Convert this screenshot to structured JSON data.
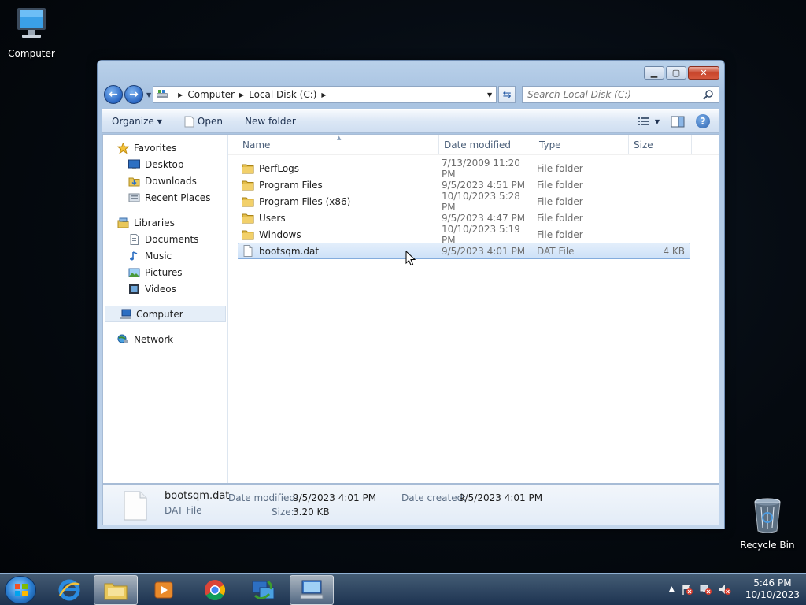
{
  "desktop": {
    "icons": [
      {
        "label": "Computer",
        "icon": "computer-icon"
      },
      {
        "label": "Recycle Bin",
        "icon": "recycle-bin-icon"
      }
    ]
  },
  "window": {
    "address": {
      "crumbs": [
        "Computer",
        "Local Disk (C:)"
      ],
      "search_placeholder": "Search Local Disk (C:)"
    },
    "toolbar": {
      "organize": "Organize",
      "open": "Open",
      "new_folder": "New folder"
    },
    "nav_pane": {
      "favorites": {
        "label": "Favorites",
        "items": [
          "Desktop",
          "Downloads",
          "Recent Places"
        ]
      },
      "libraries": {
        "label": "Libraries",
        "items": [
          "Documents",
          "Music",
          "Pictures",
          "Videos"
        ]
      },
      "computer": "Computer",
      "network": "Network"
    },
    "columns": [
      "Name",
      "Date modified",
      "Type",
      "Size"
    ],
    "files": [
      {
        "name": "PerfLogs",
        "date": "7/13/2009 11:20 PM",
        "type": "File folder",
        "size": "",
        "kind": "folder"
      },
      {
        "name": "Program Files",
        "date": "9/5/2023 4:51 PM",
        "type": "File folder",
        "size": "",
        "kind": "folder"
      },
      {
        "name": "Program Files (x86)",
        "date": "10/10/2023 5:28 PM",
        "type": "File folder",
        "size": "",
        "kind": "folder"
      },
      {
        "name": "Users",
        "date": "9/5/2023 4:47 PM",
        "type": "File folder",
        "size": "",
        "kind": "folder"
      },
      {
        "name": "Windows",
        "date": "10/10/2023 5:19 PM",
        "type": "File folder",
        "size": "",
        "kind": "folder"
      },
      {
        "name": "bootsqm.dat",
        "date": "9/5/2023 4:01 PM",
        "type": "DAT File",
        "size": "4 KB",
        "kind": "file",
        "selected": true
      }
    ],
    "details": {
      "name": "bootsqm.dat",
      "type": "DAT File",
      "modified_label": "Date modified:",
      "modified_value": "9/5/2023 4:01 PM",
      "created_label": "Date created:",
      "created_value": "9/5/2023 4:01 PM",
      "size_label": "Size:",
      "size_value": "3.20 KB"
    }
  },
  "taskbar": {
    "apps": [
      "internet-explorer-icon",
      "windows-explorer-icon",
      "media-player-icon",
      "chrome-icon",
      "network-setup-icon",
      "remote-desktop-icon"
    ],
    "active_app": "windows-explorer-icon",
    "clock_time": "5:46 PM",
    "clock_date": "10/10/2023"
  },
  "colors": {
    "selection": "#cde1f8",
    "selection_border": "#84acdd",
    "window_frame": "#b9d1ea"
  }
}
